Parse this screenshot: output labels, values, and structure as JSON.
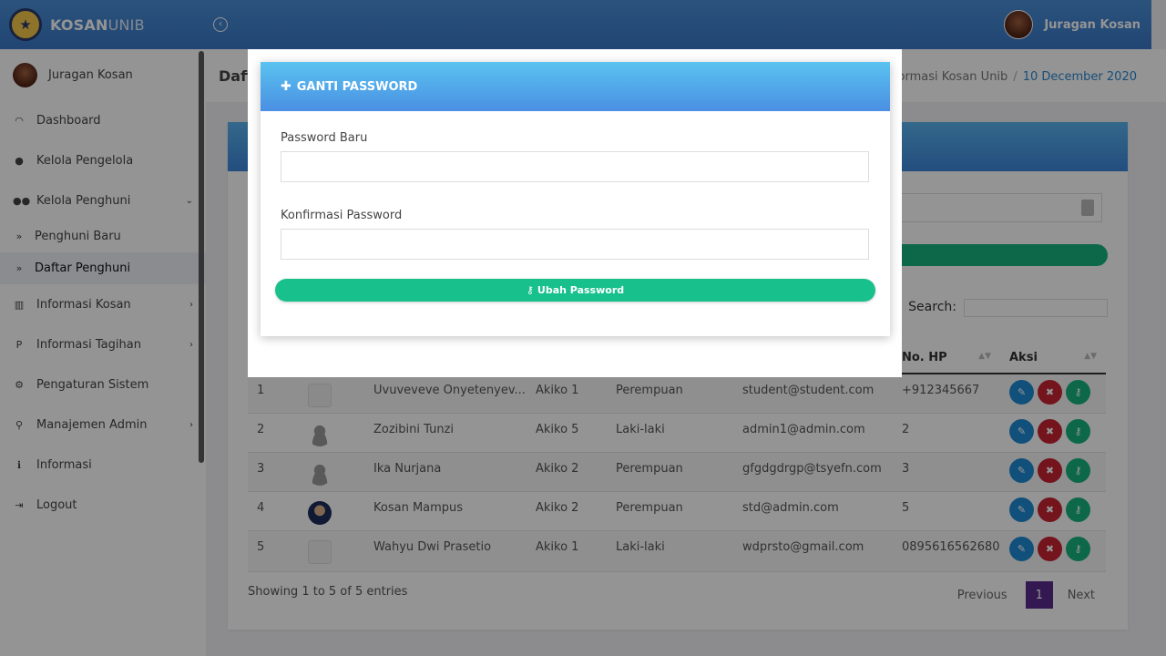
{
  "app": {
    "brand_bold": "KOSAN",
    "brand_light": "UNIB",
    "user_name": "Juragan Kosan"
  },
  "sidebar": {
    "user_name": "Juragan Kosan",
    "items": [
      {
        "label": "Dashboard",
        "icon": "dashboard-icon"
      },
      {
        "label": "Kelola Pengelola",
        "icon": "user-icon"
      },
      {
        "label": "Kelola Penghuni",
        "icon": "users-icon",
        "expanded": true
      },
      {
        "label": "Penghuni Baru",
        "icon": "double-chevron-right-icon"
      },
      {
        "label": "Daftar Penghuni",
        "icon": "double-chevron-right-icon",
        "active": true
      },
      {
        "label": "Informasi Kosan",
        "icon": "bank-icon"
      },
      {
        "label": "Informasi Tagihan",
        "icon": "paypal-icon"
      },
      {
        "label": "Pengaturan Sistem",
        "icon": "cogs-icon"
      },
      {
        "label": "Manajemen Admin",
        "icon": "bicycle-icon"
      },
      {
        "label": "Informasi",
        "icon": "info-icon"
      },
      {
        "label": "Logout",
        "icon": "sign-out-icon"
      }
    ]
  },
  "page": {
    "title": "Daft",
    "breadcrumb_1": "formasi Kosan Unib",
    "breadcrumb_2": "10 December 2020"
  },
  "table": {
    "search_label": "Search:",
    "headers": [
      "No. HP",
      "Aksi"
    ],
    "rows": [
      {
        "no": "1",
        "name": "Uvuveveve Onyetenyev...",
        "room": "Akiko 1",
        "gender": "Perempuan",
        "email": "student@student.com",
        "phone": "+912345667",
        "pic": "doc"
      },
      {
        "no": "2",
        "name": "Zozibini Tunzi",
        "room": "Akiko 5",
        "gender": "Laki-laki",
        "email": "admin1@admin.com",
        "phone": "2",
        "pic": "user"
      },
      {
        "no": "3",
        "name": "Ika Nurjana",
        "room": "Akiko 2",
        "gender": "Perempuan",
        "email": "gfgdgdrgp@tsyefn.com",
        "phone": "3",
        "pic": "user"
      },
      {
        "no": "4",
        "name": "Kosan Mampus",
        "room": "Akiko 2",
        "gender": "Perempuan",
        "email": "std@admin.com",
        "phone": "5",
        "pic": "face"
      },
      {
        "no": "5",
        "name": "Wahyu Dwi Prasetio",
        "room": "Akiko 1",
        "gender": "Laki-laki",
        "email": "wdprsto@gmail.com",
        "phone": "0895616562680",
        "pic": "doc"
      }
    ],
    "showing": "Showing 1 to 5 of 5 entries",
    "previous": "Previous",
    "page": "1",
    "next": "Next"
  },
  "modal": {
    "title": "GANTI PASSWORD",
    "field1_label": "Password Baru",
    "field1_value": "",
    "field2_label": "Konfirmasi Password",
    "field2_value": "",
    "submit": "Ubah Password"
  },
  "colors": {
    "header_blue": "#3a78c8",
    "modal_head": "#4a8fe3",
    "green": "#18c08c",
    "danger": "#c82333",
    "edit": "#1f8ad6",
    "pager_active": "#5b2a8c"
  }
}
